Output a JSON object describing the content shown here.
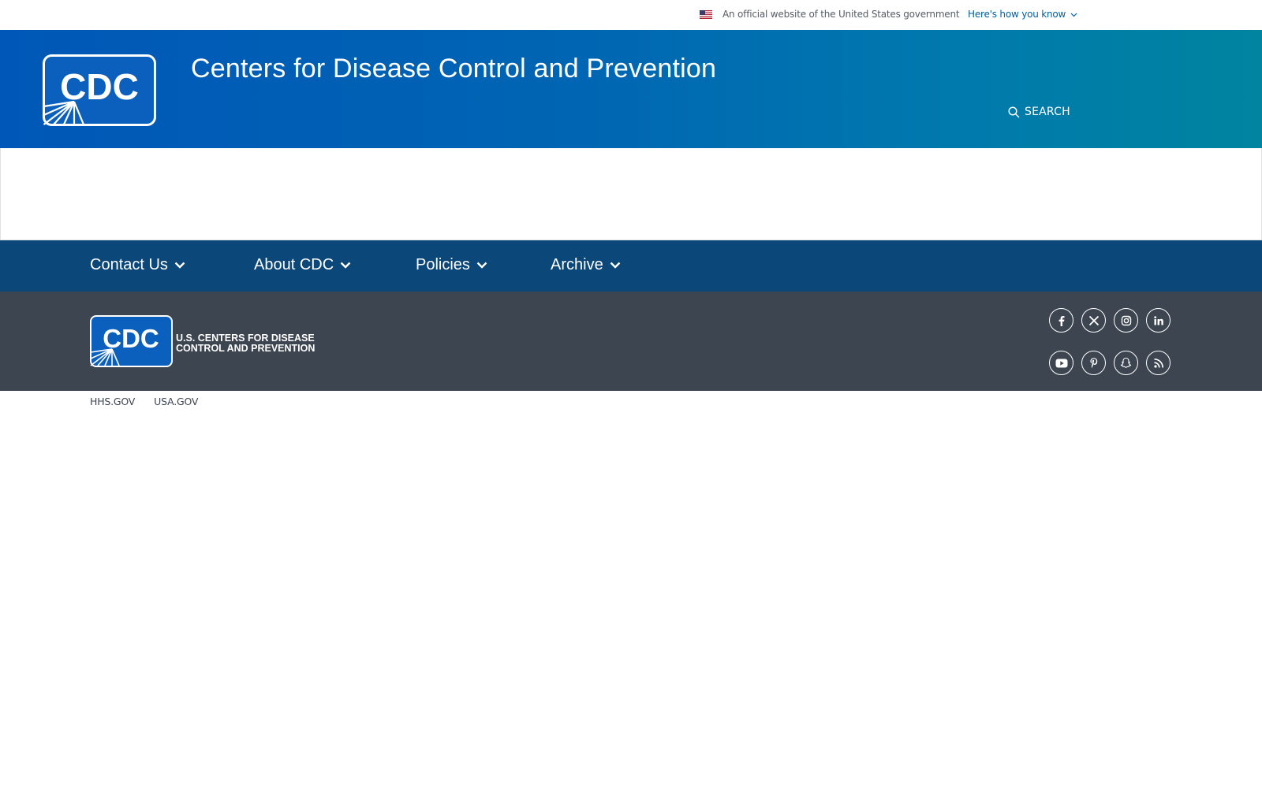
{
  "gov_banner": {
    "official_text": "An official website of the United States government",
    "how_label": "Here's how you know"
  },
  "header": {
    "logo_text": "CDC",
    "site_title": "Centers for Disease Control and Prevention",
    "search_label": "SEARCH"
  },
  "footer_nav": {
    "items": [
      {
        "label": "Contact Us"
      },
      {
        "label": "About CDC"
      },
      {
        "label": "Policies"
      },
      {
        "label": "Archive"
      }
    ]
  },
  "footer": {
    "logo_text": "CDC",
    "logo_line1": "U.S. CENTERS FOR DISEASE",
    "logo_line2": "CONTROL AND PREVENTION",
    "social_icons": [
      "facebook-icon",
      "x-icon",
      "instagram-icon",
      "linkedin-icon",
      "youtube-icon",
      "pinterest-icon",
      "snapchat-icon",
      "rss-icon"
    ]
  },
  "bottom_links": [
    {
      "label": "HHS.GOV"
    },
    {
      "label": "USA.GOV"
    }
  ],
  "colors": {
    "header_gradient_start": "#0057b7",
    "header_gradient_end": "#00849f",
    "footer_nav_bg": "#0b4778",
    "footer_bg": "#3d4551",
    "link_blue": "#005ea2"
  }
}
